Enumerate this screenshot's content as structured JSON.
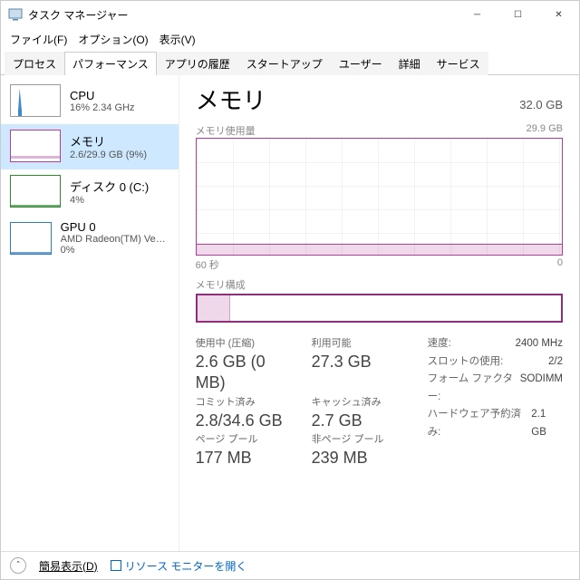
{
  "window": {
    "title": "タスク マネージャー"
  },
  "menu": {
    "file": "ファイル(F)",
    "options": "オプション(O)",
    "view": "表示(V)"
  },
  "tabs": {
    "processes": "プロセス",
    "performance": "パフォーマンス",
    "app_history": "アプリの履歴",
    "startup": "スタートアップ",
    "users": "ユーザー",
    "details": "詳細",
    "services": "サービス"
  },
  "sidebar": {
    "cpu": {
      "name": "CPU",
      "sub": "16%  2.34 GHz"
    },
    "memory": {
      "name": "メモリ",
      "sub": "2.6/29.9 GB (9%)"
    },
    "disk": {
      "name": "ディスク 0 (C:)",
      "sub": "4%"
    },
    "gpu": {
      "name": "GPU 0",
      "sub": "AMD Radeon(TM) Veg...",
      "sub2": "0%"
    }
  },
  "main": {
    "title": "メモリ",
    "capacity": "32.0 GB",
    "usage_label": "メモリ使用量",
    "usage_max": "29.9 GB",
    "x_left": "60 秒",
    "x_right": "0",
    "composition_label": "メモリ構成",
    "stats": {
      "in_use_label": "使用中 (圧縮)",
      "in_use_value": "2.6 GB (0 MB)",
      "available_label": "利用可能",
      "available_value": "27.3 GB",
      "committed_label": "コミット済み",
      "committed_value": "2.8/34.6 GB",
      "cached_label": "キャッシュ済み",
      "cached_value": "2.7 GB",
      "paged_label": "ページ プール",
      "paged_value": "177 MB",
      "nonpaged_label": "非ページ プール",
      "nonpaged_value": "239 MB"
    },
    "details": {
      "speed_k": "速度:",
      "speed_v": "2400 MHz",
      "slots_k": "スロットの使用:",
      "slots_v": "2/2",
      "form_k": "フォーム ファクター:",
      "form_v": "SODIMM",
      "reserved_k": "ハードウェア予約済み:",
      "reserved_v": "2.1 GB"
    }
  },
  "bottom": {
    "fewer": "簡易表示(D)",
    "resmon": "リソース モニターを開く"
  }
}
